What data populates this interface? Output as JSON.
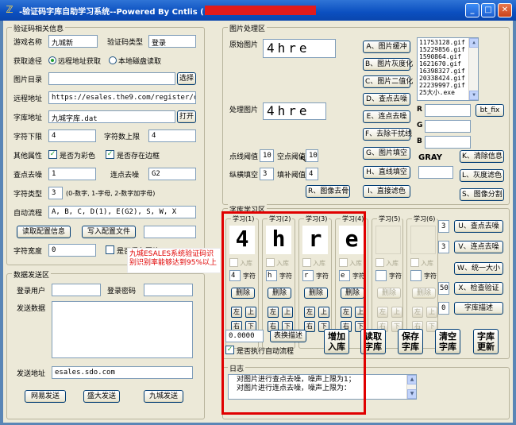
{
  "window": {
    "title": "-验证码字库自助学习系统--Powered By Cntlis (",
    "min": "_",
    "max": "□",
    "close": "✕"
  },
  "left_group": {
    "title": "验证码相关信息",
    "game_name_label": "游戏名称",
    "game_name_value": "九城新",
    "code_type_label": "验证码类型",
    "code_type_value": "登录",
    "fetch_label": "获取途径",
    "fetch_remote": "远程地址获取",
    "fetch_local": "本地磁盘读取",
    "image_dir_label": "图片目录",
    "image_dir_value": "",
    "choose_button": "选择",
    "remote_addr_label": "远程地址",
    "remote_addr_value": "https://esales.the9.com/register/checkre",
    "font_addr_label": "字库地址",
    "font_addr_value": "九城字库.dat",
    "open_button": "打开",
    "char_min_label": "字符下限",
    "char_min_value": "4",
    "char_max_label": "字符数上限",
    "char_max_value": "4",
    "other_label": "其他属性",
    "is_color": "是否为彩色",
    "has_border": "是否存在边框",
    "denoise_label": "查点去噪",
    "denoise_value": "1",
    "connect_denoise_label": "连点去噪",
    "connect_denoise_value": "G2",
    "char_type_label": "字符类型",
    "char_type_value": "3",
    "char_type_hint": "(0-数字, 1-字母, 2-数字加字母)",
    "auto_flow_label": "自动流程",
    "auto_flow_value": "A, B, C, D(1), E(G2), S, W, X",
    "read_config_button": "读取配置信息",
    "write_config_button": "写入配置文件",
    "char_width_label": "字符宽度",
    "char_width_value": "0",
    "save_images_label": "是否保存图片"
  },
  "send_group": {
    "title": "数据发送区",
    "user_label": "登录用户",
    "password_label": "登录密码",
    "send_data_label": "发送数据",
    "send_addr_label": "发送地址",
    "send_addr_value": "esales.sdo.com",
    "btn1": "网易发送",
    "btn2": "盛大发送",
    "btn3": "九城发送"
  },
  "image_group": {
    "title": "图片处理区",
    "original_label": "原始图片",
    "original_text": "4hre",
    "processed_label": "处理图片",
    "processed_text": "4hre",
    "buttons_col1": [
      "A、图片缓冲",
      "B、图片灰度化",
      "C、图片二值化",
      "D、查点去噪",
      "E、连点去噪",
      "F、去除干扰线",
      "G、图片填空",
      "H、直线填空",
      "I、直接滤色"
    ],
    "file_list": [
      "11753128.gif",
      "15229856.gif",
      "1590864.gif",
      "1621670.gif",
      "16398327.gif",
      "20338424.gif",
      "22239997.gif",
      "25大小.exe"
    ],
    "r_label": "R",
    "g_label": "G",
    "b_label": "B",
    "gray_label": "GRAY",
    "bt_fix": "bt_fix",
    "buttons_col3": [
      "K、清除信息",
      "L、灰度滤色",
      "S、图像分割"
    ],
    "point_threshold_label": "点线阈值",
    "point_threshold_value": "10",
    "space_threshold_label": "空点阈值",
    "space_threshold_value": "10",
    "vfill_label": "纵横填空",
    "vfill_value": "3",
    "fill_threshold_label": "填补阈值",
    "fill_threshold_value": "4",
    "remove_image_button": "R、图像去骨"
  },
  "font_group": {
    "title": "字库学习区",
    "slots": [
      {
        "title": "学习(1)",
        "glyph": "4",
        "char": "4",
        "enabled": true
      },
      {
        "title": "学习(2)",
        "glyph": "h",
        "char": "h",
        "enabled": true
      },
      {
        "title": "学习(3)",
        "glyph": "r",
        "char": "r",
        "enabled": true
      },
      {
        "title": "学习(4)",
        "glyph": "e",
        "char": "e",
        "enabled": true
      },
      {
        "title": "学习(5)",
        "glyph": "",
        "char": "",
        "enabled": false
      },
      {
        "title": "学习(6)",
        "glyph": "",
        "char": "",
        "enabled": false
      }
    ],
    "in_lib": "入库",
    "char_lbl": "字符",
    "delete": "删除",
    "left": "左",
    "up": "上",
    "right": "右",
    "down": "下",
    "side_values": [
      "3",
      "3",
      "500",
      "0"
    ],
    "side_buttons": [
      "U、查点去噪",
      "V、连点去噪",
      "W、统一大小",
      "X、检查验证",
      "字库描述"
    ],
    "float_value": "0.0000",
    "swap_button": "表换描述",
    "auto_flow_check": "是否执行自动流程",
    "big_buttons": [
      "增加入库",
      "读取字库",
      "保存字库",
      "清空字库",
      "字库更新"
    ]
  },
  "log_group": {
    "title": "日志",
    "lines": [
      "对图片进行查点去噪，噪声上限为1；",
      "对图片进行连点去噪，噪声上限为："
    ]
  },
  "annotation": {
    "text": "九城ESALES系统验证码识别识别率能够达到95%以上"
  }
}
